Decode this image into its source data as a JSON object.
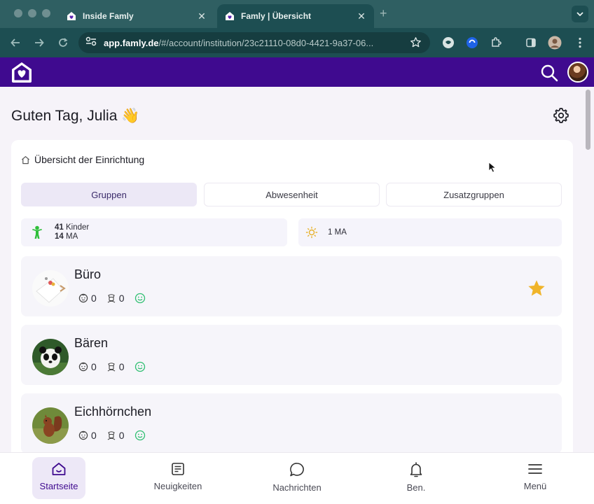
{
  "browser": {
    "tabs": [
      {
        "title": "Inside Famly",
        "active": false
      },
      {
        "title": "Famly | Übersicht",
        "active": true
      }
    ],
    "url_host": "app.famly.de",
    "url_path": "/#/account/institution/23c21110-08d0-4421-9a37-06..."
  },
  "page": {
    "greeting": "Guten Tag, Julia 👋",
    "breadcrumb": "Übersicht der Einrichtung",
    "segments": [
      "Gruppen",
      "Abwesenheit",
      "Zusatzgruppen"
    ],
    "active_segment": "Gruppen",
    "stats": {
      "children_count": "41",
      "children_label": "Kinder",
      "staff_count": "14",
      "staff_label": "MA",
      "sun_count": "1",
      "sun_label": "MA"
    },
    "groups": [
      {
        "name": "Büro",
        "children": "0",
        "staff": "0",
        "favorite": true
      },
      {
        "name": "Bären",
        "children": "0",
        "staff": "0",
        "favorite": false
      },
      {
        "name": "Eichhörnchen",
        "children": "0",
        "staff": "0",
        "favorite": false
      }
    ]
  },
  "nav": {
    "items": [
      {
        "label": "Startseite",
        "active": true
      },
      {
        "label": "Neuigkeiten",
        "active": false
      },
      {
        "label": "Nachrichten",
        "active": false
      },
      {
        "label": "Ben.",
        "active": false
      },
      {
        "label": "Menü",
        "active": false
      }
    ]
  },
  "colors": {
    "brand": "#3f0a8f",
    "chrome_frame": "#1d4e52",
    "active_segment_bg": "#ece8f6",
    "favorite_star": "#f0b429",
    "smiley": "#2fbf71"
  },
  "icons": [
    "famly-logo-icon",
    "search-icon",
    "settings-gear-icon",
    "home-icon",
    "child-figure-icon",
    "sun-icon",
    "child-face-icon",
    "staff-icon",
    "smiley-icon",
    "star-icon",
    "newspaper-icon",
    "chat-bubble-icon",
    "bell-icon",
    "hamburger-menu-icon"
  ]
}
